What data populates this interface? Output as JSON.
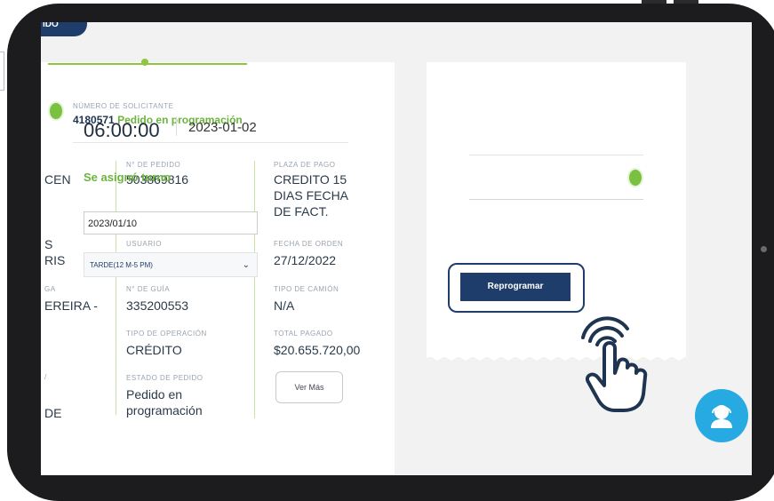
{
  "tag": {
    "text": "IDO"
  },
  "solicitor": {
    "label": "NÚMERO DE SOLICITANTE",
    "number": "4180571",
    "status": "Pedido en programación"
  },
  "col1": {
    "val_a": "CEN",
    "val_b_line1": "S",
    "val_b_line2": "RIS",
    "label_c": "GA",
    "val_c": "EREIRA -",
    "val_d": "DE"
  },
  "col2": {
    "pedido_label": "N° DE PEDIDO",
    "pedido_value": "503869816",
    "usuario_label": "USUARIO",
    "guia_label": "N° DE GUÍA",
    "guia_value": "335200553",
    "operacion_label": "TIPO DE OPERACIÓN",
    "operacion_value": "CRÉDITO",
    "estado_label": "ESTADO DE PEDIDO",
    "estado_value_line1": "Pedido en",
    "estado_value_line2": "programación"
  },
  "col3": {
    "plaza_label": "PLAZA DE PAGO",
    "plaza_line1": "CREDITO 15",
    "plaza_line2": "DIAS FECHA",
    "plaza_line3": "DE FACT.",
    "fecha_label": "FECHA DE ORDEN",
    "fecha_value": "27/12/2022",
    "camion_label": "TIPO DE CAMIÓN",
    "camion_value": "N/A",
    "total_label": "TOTAL PAGADO",
    "total_value": "$20.655.720,00",
    "ver_mas": "Ver Más"
  },
  "schedule": {
    "time": "06:00:00",
    "date": "2023-01-02",
    "turno_status": "Se asignó turno",
    "date_input_value": "2023/01/10",
    "shift_selected": "TARDE(12 M-5 PM)",
    "reprogram_button": "Reprogramar"
  },
  "icons": {
    "chevron": "chevron-down-icon",
    "chat": "support-agent-icon",
    "hand": "hand-pointer-icon"
  },
  "colors": {
    "primary": "#1f3d6b",
    "accent_green": "#6db33f",
    "chat_blue": "#27a9e1"
  }
}
